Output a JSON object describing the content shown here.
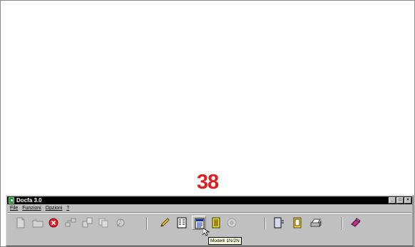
{
  "page_number": "38",
  "window": {
    "title": "Docfa 3.0",
    "minimize_label": "_",
    "maximize_label": "□",
    "close_label": "×"
  },
  "menu": {
    "items": [
      "File",
      "Funzioni",
      "Opzioni",
      "?"
    ]
  },
  "toolbar": {
    "buttons": [
      {
        "icon": "new-document-icon",
        "enabled": false
      },
      {
        "icon": "open-folder-icon",
        "enabled": false
      },
      {
        "icon": "delete-icon",
        "enabled": true
      },
      {
        "icon": "network-icon",
        "enabled": false
      },
      {
        "icon": "transfer-icon",
        "enabled": false
      },
      {
        "icon": "copy-icon",
        "enabled": false
      },
      {
        "icon": "tools-icon",
        "enabled": false
      },
      {
        "icon": "pencil-icon",
        "enabled": true
      },
      {
        "icon": "form-icon",
        "enabled": true
      },
      {
        "icon": "modelli-icon",
        "enabled": true,
        "pressed": true
      },
      {
        "icon": "list-icon",
        "enabled": true
      },
      {
        "icon": "disk-icon",
        "enabled": false
      },
      {
        "icon": "document-view-icon",
        "enabled": true
      },
      {
        "icon": "notepad-icon",
        "enabled": true
      },
      {
        "icon": "printer-icon",
        "enabled": true
      },
      {
        "icon": "eraser-icon",
        "enabled": true
      }
    ]
  },
  "tooltip": {
    "text": "Modelli 1N/2N"
  },
  "colors": {
    "page_number": "#e01e1e",
    "title_bar": "#000000",
    "window_bg": "#c0c0c0",
    "tooltip_bg": "#ffffe1"
  }
}
